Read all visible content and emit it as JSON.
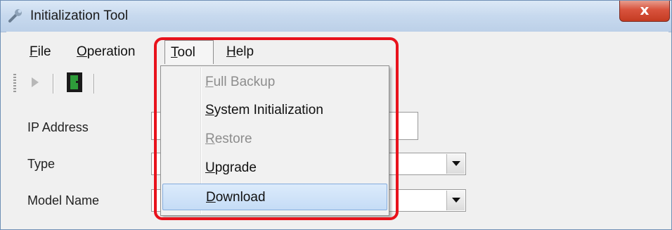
{
  "window": {
    "title": "Initialization Tool",
    "close_glyph": "x"
  },
  "menubar": {
    "items": [
      {
        "key": "F",
        "rest": "ile"
      },
      {
        "key": "O",
        "rest": "peration"
      },
      {
        "key": "T",
        "rest": "ool"
      },
      {
        "key": "H",
        "rest": "elp"
      }
    ]
  },
  "toolbar": {
    "buttons": [
      "play-icon",
      "exit-door-icon"
    ]
  },
  "form": {
    "labels": [
      "IP Address",
      "Type",
      "Model Name"
    ]
  },
  "tool_menu": {
    "items": [
      {
        "key": "F",
        "rest": "ull Backup",
        "enabled": false
      },
      {
        "key": "S",
        "rest": "ystem Initialization",
        "enabled": true
      },
      {
        "key": "R",
        "rest": "estore",
        "enabled": false
      },
      {
        "key": "U",
        "rest": "pgrade",
        "enabled": true
      },
      {
        "key": "D",
        "rest": "ownload",
        "enabled": true,
        "highlighted": true
      }
    ]
  },
  "colors": {
    "annotation_outline": "#e8121c",
    "highlight": "#c5dcf6",
    "disabled_text": "#8d8d8d"
  }
}
